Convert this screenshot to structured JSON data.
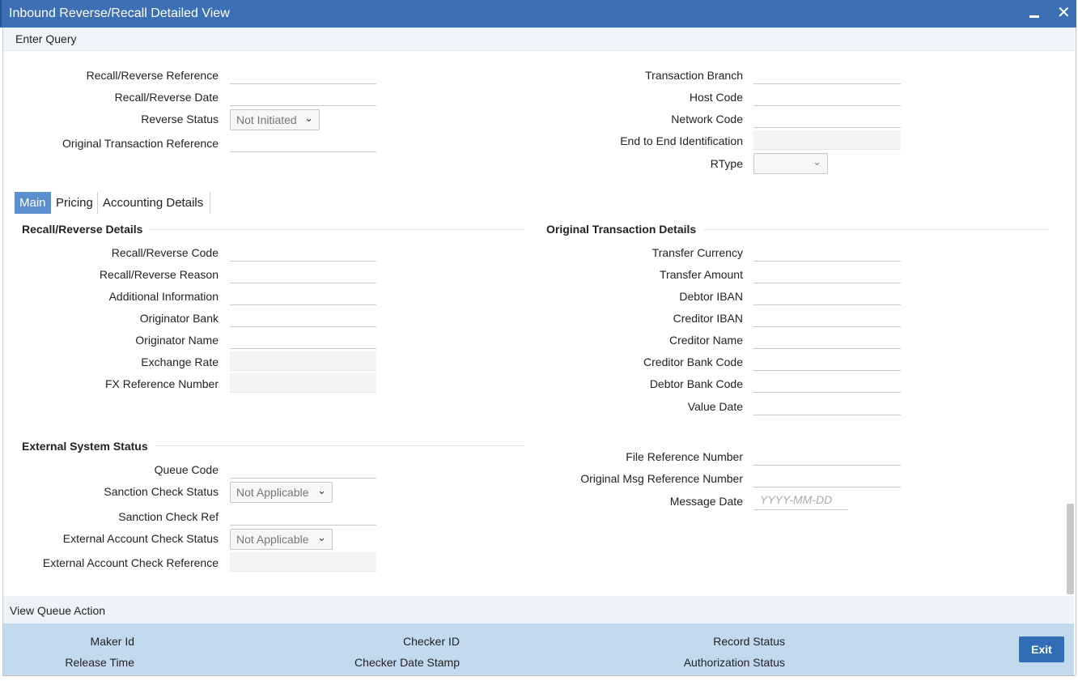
{
  "window": {
    "title": "Inbound Reverse/Recall Detailed View"
  },
  "toolbar": {
    "enter_query": "Enter Query"
  },
  "header": {
    "left": {
      "recall_reverse_reference": "Recall/Reverse Reference",
      "recall_reverse_date": "Recall/Reverse Date",
      "reverse_status": "Reverse Status",
      "reverse_status_value": "Not Initiated",
      "original_transaction_reference": "Original Transaction Reference"
    },
    "right": {
      "transaction_branch": "Transaction Branch",
      "host_code": "Host Code",
      "network_code": "Network Code",
      "end_to_end_identification": "End to End Identification",
      "rtype": "RType",
      "rtype_value": ""
    }
  },
  "tabs": [
    "Main",
    "Pricing",
    "Accounting Details"
  ],
  "recall_details": {
    "heading": "Recall/Reverse Details",
    "recall_reverse_code": "Recall/Reverse Code",
    "recall_reverse_reason": "Recall/Reverse Reason",
    "additional_information": "Additional Information",
    "originator_bank": "Originator Bank",
    "originator_name": "Originator Name",
    "exchange_rate": "Exchange Rate",
    "fx_reference_number": "FX Reference Number"
  },
  "original_details": {
    "heading": "Original Transaction Details",
    "transfer_currency": "Transfer Currency",
    "transfer_amount": "Transfer Amount",
    "debtor_iban": "Debtor IBAN",
    "creditor_iban": "Creditor IBAN",
    "creditor_name": "Creditor Name",
    "creditor_bank_code": "Creditor Bank Code",
    "debtor_bank_code": "Debtor Bank Code",
    "value_date": "Value Date"
  },
  "external_status": {
    "heading": "External System Status",
    "queue_code": "Queue Code",
    "sanction_check_status": "Sanction Check Status",
    "sanction_check_status_value": "Not Applicable",
    "sanction_check_ref": "Sanction Check Ref",
    "external_account_check_status": "External Account Check Status",
    "external_account_check_status_value": "Not Applicable",
    "external_account_check_reference": "External Account Check Reference"
  },
  "file_details": {
    "file_reference_number": "File Reference Number",
    "original_msg_reference_number": "Original Msg Reference Number",
    "message_date": "Message Date",
    "message_date_placeholder": "YYYY-MM-DD"
  },
  "view_queue_action": "View Queue Action",
  "footer": {
    "maker_id": "Maker Id",
    "release_time": "Release Time",
    "checker_id": "Checker ID",
    "checker_date_stamp": "Checker Date Stamp",
    "record_status": "Record Status",
    "authorization_status": "Authorization Status",
    "exit": "Exit"
  }
}
